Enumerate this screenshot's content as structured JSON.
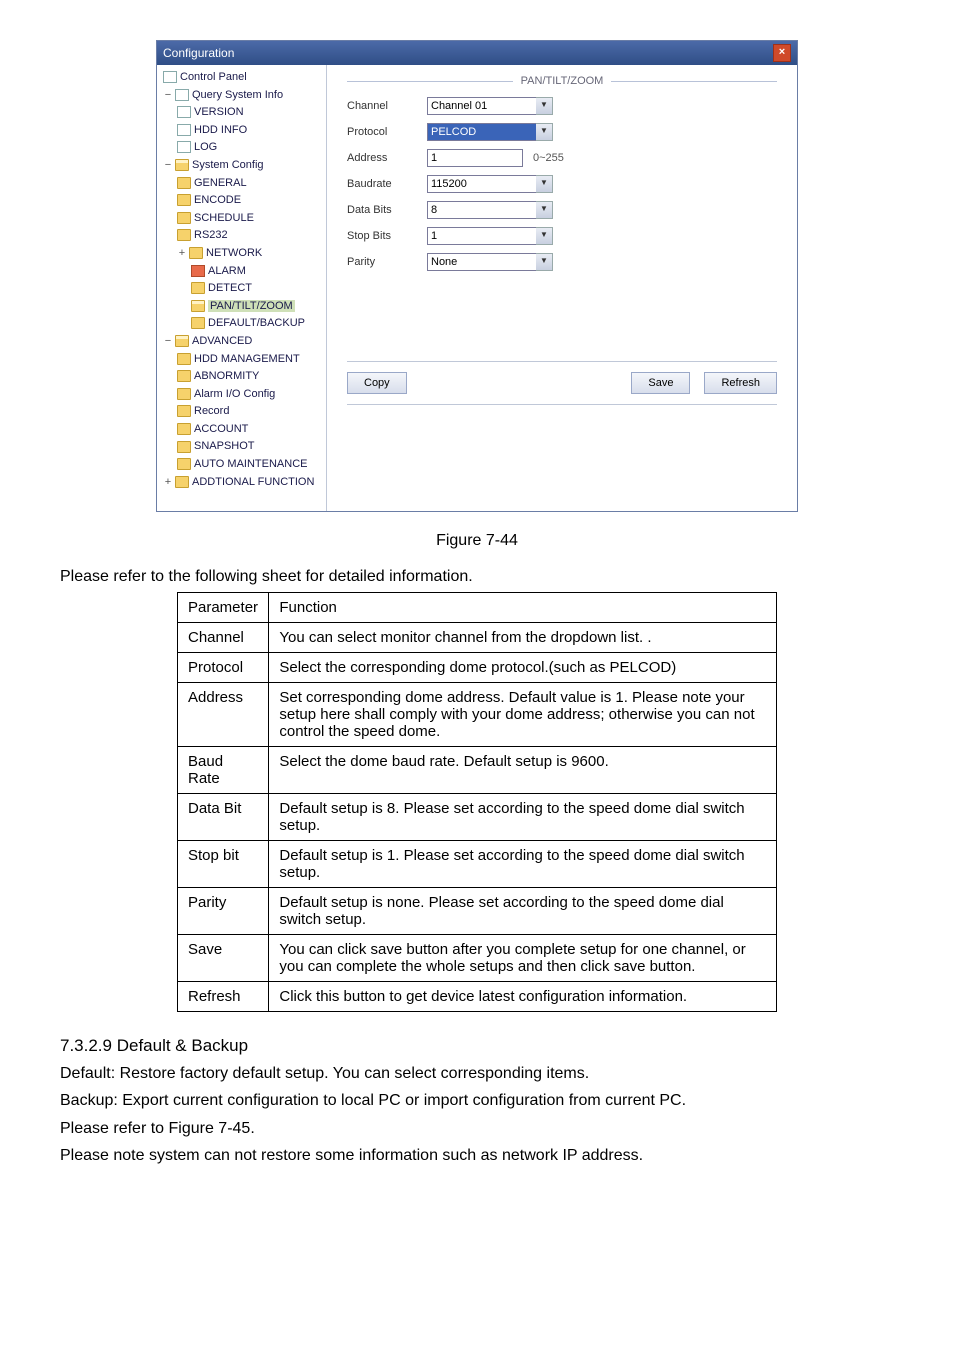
{
  "window": {
    "title": "Configuration",
    "section_title": "PAN/TILT/ZOOM"
  },
  "tree": {
    "root": "Control Panel",
    "query": {
      "label": "Query System Info",
      "items": [
        "VERSION",
        "HDD INFO",
        "LOG"
      ]
    },
    "sysconfig": {
      "label": "System Config",
      "items": [
        "GENERAL",
        "ENCODE",
        "SCHEDULE",
        "RS232"
      ],
      "network": "NETWORK",
      "network_sub": [
        "ALARM",
        "DETECT",
        "PAN/TILT/ZOOM",
        "DEFAULT/BACKUP"
      ]
    },
    "advanced": {
      "label": "ADVANCED",
      "items": [
        "HDD MANAGEMENT",
        "ABNORMITY",
        "Alarm I/O Config",
        "Record",
        "ACCOUNT",
        "SNAPSHOT",
        "AUTO MAINTENANCE"
      ]
    },
    "addfunc": "ADDTIONAL FUNCTION"
  },
  "form": {
    "channel": {
      "label": "Channel",
      "value": "Channel 01"
    },
    "protocol": {
      "label": "Protocol",
      "value": "PELCOD"
    },
    "address": {
      "label": "Address",
      "value": "1",
      "hint": "0~255"
    },
    "baudrate": {
      "label": "Baudrate",
      "value": "115200"
    },
    "databits": {
      "label": "Data Bits",
      "value": "8"
    },
    "stopbits": {
      "label": "Stop Bits",
      "value": "1"
    },
    "parity": {
      "label": "Parity",
      "value": "None"
    }
  },
  "buttons": {
    "copy": "Copy",
    "save": "Save",
    "refresh": "Refresh"
  },
  "figure_caption": "Figure 7-44",
  "intro_text": "Please refer to the following sheet for detailed information.",
  "table": {
    "headers": [
      "Parameter",
      "Function"
    ],
    "rows": [
      [
        "Channel",
        "You can select monitor channel from the dropdown list. ."
      ],
      [
        "Protocol",
        "Select the corresponding dome protocol.(such as PELCOD)"
      ],
      [
        "Address",
        "Set corresponding dome address. Default value is 1. Please note your setup here shall comply with your dome address; otherwise you can not control the speed dome."
      ],
      [
        "Baud Rate",
        "Select the dome baud rate. Default setup is 9600."
      ],
      [
        "Data Bit",
        "Default setup is 8. Please set according to the speed dome dial switch setup."
      ],
      [
        "Stop bit",
        "Default setup is 1. Please set according to the speed dome dial switch setup."
      ],
      [
        "Parity",
        "Default setup is none. Please set according to the speed dome dial switch setup."
      ],
      [
        "Save",
        "You can click save button after you complete setup for one channel, or you can complete the whole setups and then click save button."
      ],
      [
        "Refresh",
        "Click this button to get device latest configuration information."
      ]
    ]
  },
  "section": {
    "num_title": "7.3.2.9  Default & Backup",
    "p1": "Default: Restore factory default setup. You can select corresponding items.",
    "p2": "Backup: Export current configuration to local PC or import configuration from current PC.",
    "p3": "Please refer to Figure 7-45.",
    "p4": "Please note system can not restore some information such as network IP address."
  }
}
